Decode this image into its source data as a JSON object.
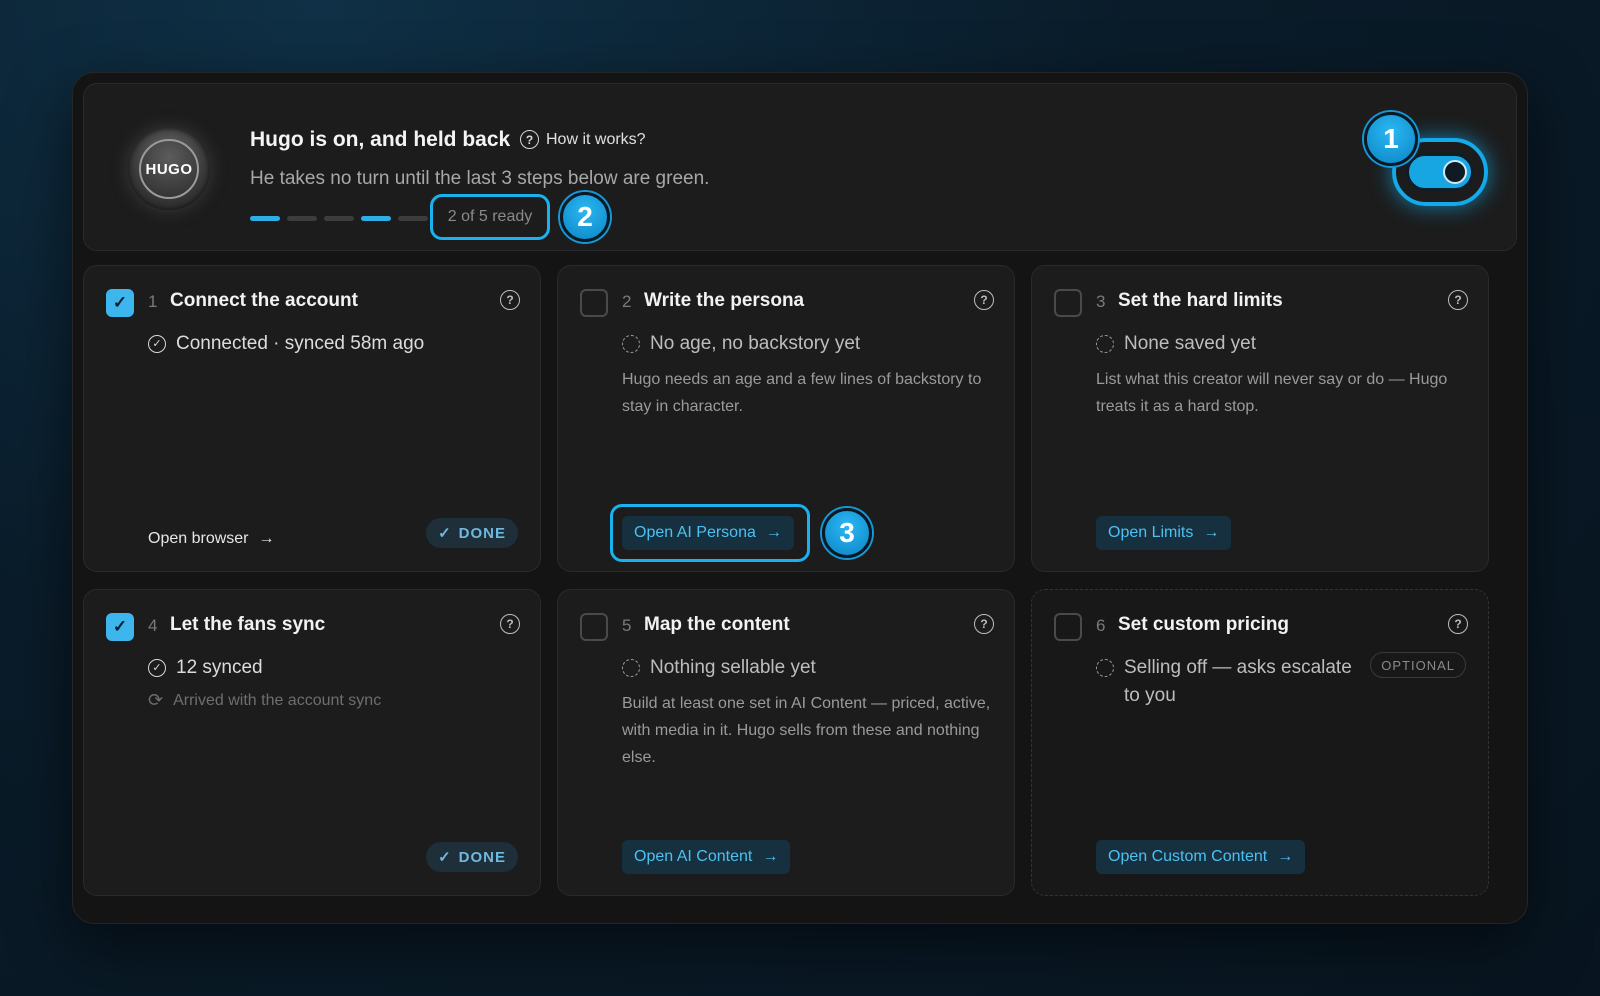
{
  "header": {
    "logo_text": "HUGO",
    "title": "Hugo is on, and held back",
    "how_label": "How it works?",
    "subtitle": "He takes no turn until the last 3 steps below are green.",
    "progress": {
      "ready": 2,
      "total": 5,
      "segments": [
        true,
        false,
        false,
        true,
        false
      ]
    },
    "ready_label": "2 of 5 ready",
    "toggle_on": true
  },
  "callouts": [
    "1",
    "2",
    "3"
  ],
  "colors": {
    "accent": "#2eaee6",
    "card": "#1c1c1c",
    "page": "#141414"
  },
  "cards": [
    {
      "num": "1",
      "title": "Connect the account",
      "checked": true,
      "status": "Connected · synced 58m ago",
      "action": "Open browser",
      "done": "DONE"
    },
    {
      "num": "2",
      "title": "Write the persona",
      "checked": false,
      "status": "No age, no backstory yet",
      "desc": "Hugo needs an age and a few lines of backstory to stay in character.",
      "action": "Open AI Persona"
    },
    {
      "num": "3",
      "title": "Set the hard limits",
      "checked": false,
      "status": "None saved yet",
      "desc": "List what this creator will never say or do — Hugo treats it as a hard stop.",
      "action": "Open Limits"
    },
    {
      "num": "4",
      "title": "Let the fans sync",
      "checked": true,
      "status": "12 synced",
      "note": "Arrived with the account sync",
      "done": "DONE"
    },
    {
      "num": "5",
      "title": "Map the content",
      "checked": false,
      "status": "Nothing sellable yet",
      "desc": "Build at least one set in AI Content — priced, active, with media in it. Hugo sells from these and nothing else.",
      "action": "Open AI Content"
    },
    {
      "num": "6",
      "title": "Set custom pricing",
      "checked": false,
      "status_line1": "Selling off — asks escalate",
      "status_line2": "to you",
      "badge": "OPTIONAL",
      "action": "Open Custom Content"
    }
  ]
}
